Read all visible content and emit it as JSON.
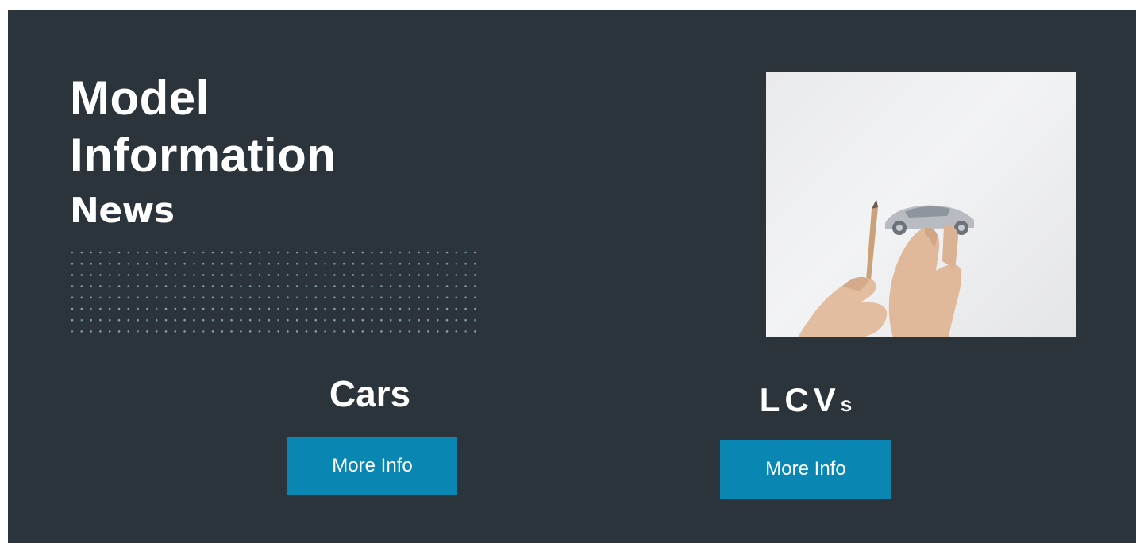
{
  "header": {
    "title_line1": "Model",
    "title_line2": "Information",
    "subtitle": "News"
  },
  "categories": [
    {
      "label": "Cars",
      "button_label": "More Info"
    },
    {
      "label_main": "LCV",
      "label_suffix": "s",
      "button_label": "More Info"
    }
  ],
  "hero_image": {
    "icon": "model-car-photo"
  },
  "colors": {
    "background": "#2b343b",
    "button": "#0a86b3",
    "text": "#ffffff"
  }
}
